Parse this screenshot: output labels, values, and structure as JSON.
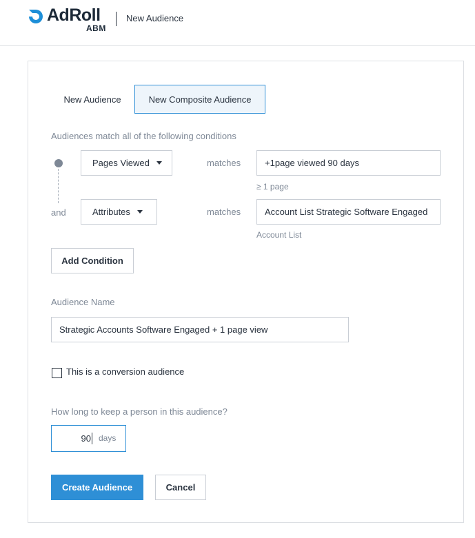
{
  "header": {
    "logo_text": "AdRoll",
    "logo_sub": "ABM",
    "title": "New Audience"
  },
  "tabs": [
    {
      "label": "New Audience",
      "active": false
    },
    {
      "label": "New Composite Audience",
      "active": true
    }
  ],
  "conditions": {
    "label": "Audiences match all of the following conditions",
    "joiner": "and",
    "items": [
      {
        "field": "Pages Viewed",
        "operator": "matches",
        "value": "+1page viewed 90 days",
        "sub": "≥ 1 page"
      },
      {
        "field": "Attributes",
        "operator": "matches",
        "value": "Account List Strategic Software Engaged",
        "sub": "Account List"
      }
    ],
    "add_label": "Add Condition"
  },
  "audience_name": {
    "label": "Audience Name",
    "value": "Strategic Accounts Software Engaged + 1 page view"
  },
  "conversion": {
    "label": "This is a conversion audience",
    "checked": false
  },
  "duration": {
    "label": "How long to keep a person in this audience?",
    "value": "90",
    "unit": "days"
  },
  "actions": {
    "create_label": "Create Audience",
    "cancel_label": "Cancel"
  },
  "colors": {
    "accent": "#2e8fd6",
    "text": "#2b3440",
    "muted": "#7e8896"
  }
}
